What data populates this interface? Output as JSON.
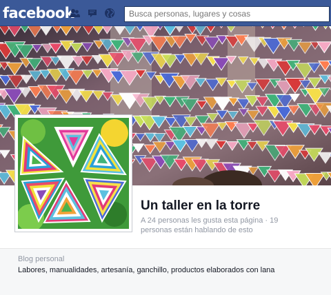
{
  "topbar": {
    "logo": "facebook",
    "search_placeholder": "Busca personas, lugares y cosas",
    "icons": [
      "friend-requests-icon",
      "messages-icon",
      "notifications-globe-icon"
    ]
  },
  "colors": {
    "brand_blue": "#3b5998",
    "brand_border": "#29447e",
    "muted_text": "#9197a3",
    "dark_text": "#141823",
    "about_background": "#f6f7f8"
  },
  "page": {
    "name": "Un taller en la torre",
    "stats": "A 24 personas les gusta esta página · 19 personas están hablando de esto"
  },
  "about": {
    "category": "Blog personal",
    "description": "Labores, manualidades, artesanía, ganchillo, productos elaborados con lana"
  }
}
